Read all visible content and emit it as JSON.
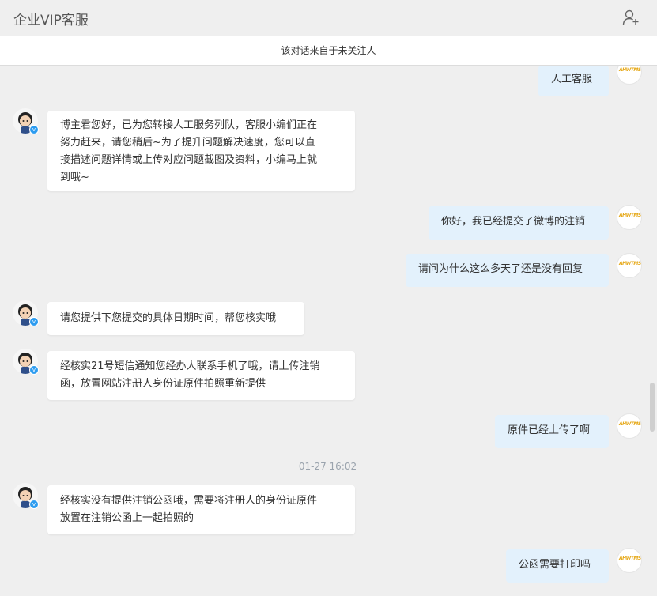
{
  "header": {
    "title": "企业VIP客服",
    "add_contact_icon": "add-user-icon"
  },
  "notice": {
    "text": "该对话来自于未关注人"
  },
  "messages": {
    "m0": {
      "side": "right",
      "text": "人工客服"
    },
    "m1": {
      "side": "left",
      "lines": [
        "博主君您好，已为您转接人工服务列队，客服小编们正在",
        "努力赶来，请您稍后~为了提升问题解决速度，您可以直",
        "接描述问题详情或上传对应问题截图及资料，小编马上就",
        "到哦~"
      ]
    },
    "m2": {
      "side": "right",
      "text": "你好，我已经提交了微博的注销"
    },
    "m3": {
      "side": "right",
      "text": "请问为什么这么多天了还是没有回复"
    },
    "m4": {
      "side": "left",
      "lines": [
        "请您提供下您提交的具体日期时间，帮您核实哦"
      ]
    },
    "m5": {
      "side": "left",
      "lines": [
        "经核实21号短信通知您经办人联系手机了哦，请上传注销",
        "函，放置网站注册人身份证原件拍照重新提供"
      ]
    },
    "m6": {
      "side": "right",
      "text": "原件已经上传了啊"
    },
    "m7": {
      "side": "left",
      "lines": [
        "经核实没有提供注销公函哦，需要将注册人的身份证原件",
        "放置在注销公函上一起拍照的"
      ]
    },
    "m8": {
      "side": "right",
      "text": "公函需要打印吗"
    }
  },
  "timestamp": "01-27 16:02",
  "colors": {
    "bubble_right": "#e3f1fc",
    "bubble_left": "#ffffff",
    "background": "#efefef",
    "verified_badge": "#2d9cf0"
  },
  "icons": {
    "agent_avatar": "agent-avatar",
    "user_avatar": "user-avatar-logo",
    "verified": "verified-badge-icon"
  },
  "user_logo": {
    "main": "AHW",
    "sup": "TMS"
  }
}
